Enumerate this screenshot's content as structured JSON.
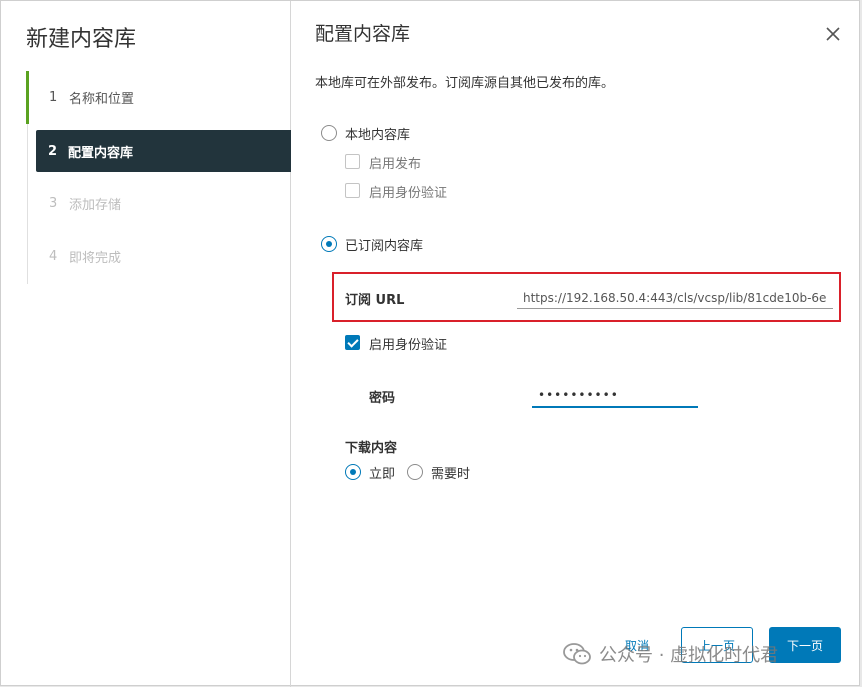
{
  "wizard": {
    "title": "新建内容库",
    "steps": [
      {
        "num": "1",
        "label": "名称和位置"
      },
      {
        "num": "2",
        "label": "配置内容库"
      },
      {
        "num": "3",
        "label": "添加存储"
      },
      {
        "num": "4",
        "label": "即将完成"
      }
    ]
  },
  "content": {
    "title": "配置内容库",
    "description": "本地库可在外部发布。订阅库源自其他已发布的库。",
    "local_library": {
      "label": "本地内容库",
      "enable_publish": "启用发布",
      "enable_auth": "启用身份验证"
    },
    "subscribed_library": {
      "label": "已订阅内容库",
      "url_label": "订阅 URL",
      "url_value": "https://192.168.50.4:443/cls/vcsp/lib/81cde10b-6e",
      "enable_auth": "启用身份验证",
      "password_label": "密码",
      "password_value": "••••••••••"
    },
    "download": {
      "label": "下载内容",
      "immediately": "立即",
      "when_needed": "需要时"
    }
  },
  "footer": {
    "cancel": "取消",
    "back": "上一页",
    "next": "下一页"
  },
  "watermark": {
    "text": "公众号 · 虚拟化时代君"
  },
  "colors": {
    "accent": "#0079b8",
    "active_step_bg": "#22343c",
    "done_step": "#5aa220",
    "highlight_border": "#d9202a"
  }
}
